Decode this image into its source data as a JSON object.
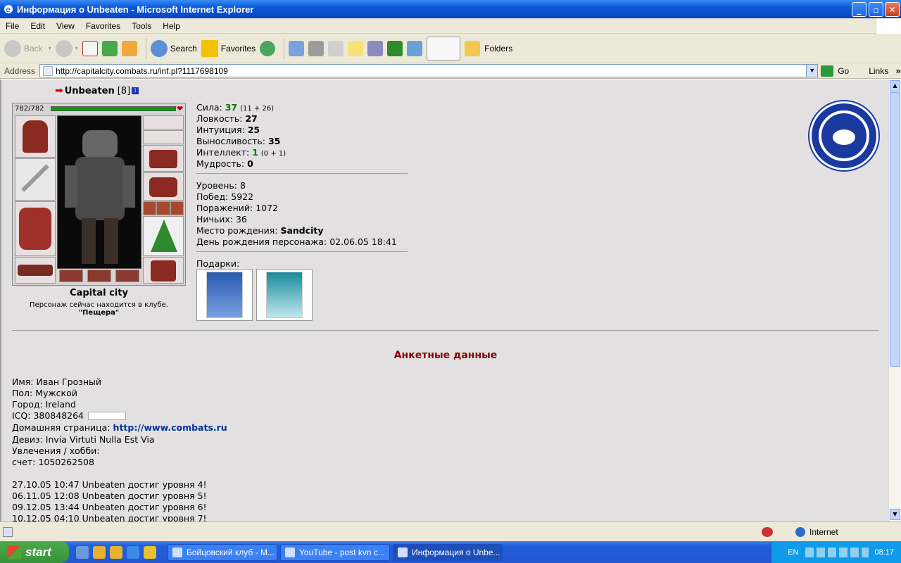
{
  "window": {
    "title": "Информация о Unbeaten - Microsoft Internet Explorer"
  },
  "menu": [
    "File",
    "Edit",
    "View",
    "Favorites",
    "Tools",
    "Help"
  ],
  "toolbar": {
    "back": "Back",
    "search": "Search",
    "favorites": "Favorites",
    "folders": "Folders"
  },
  "address": {
    "label": "Address",
    "url": "http://capitalcity.combats.ru/inf.pl?1117698109",
    "go": "Go",
    "links": "Links"
  },
  "character": {
    "name": "Unbeaten",
    "level": "[8]",
    "hp": "782/782",
    "city": "Capital city",
    "location_note": "Персонаж сейчас находится в клубе.",
    "location": "\"Пещера\""
  },
  "stats": [
    {
      "label": "Сила:",
      "value": "37",
      "extra": "(11 + 26)",
      "green": true
    },
    {
      "label": "Ловкость:",
      "value": "27",
      "extra": "",
      "green": false
    },
    {
      "label": "Интуиция:",
      "value": "25",
      "extra": "",
      "green": false
    },
    {
      "label": "Выносливость:",
      "value": "35",
      "extra": "",
      "green": false
    },
    {
      "label": "Интеллект:",
      "value": "1",
      "extra": "(0 + 1)",
      "green": true
    },
    {
      "label": "Мудрость:",
      "value": "0",
      "extra": "",
      "green": false
    }
  ],
  "info": {
    "level": "Уровень: 8",
    "wins": "Побед: 5922",
    "losses": "Поражений: 1072",
    "draws": "Ничьих: 36",
    "birthplace_label": "Место рождения:",
    "birthplace": "Sandcity",
    "birthday": "День рождения персонажа: 02.06.05 18:41",
    "gifts_label": "Подарки:"
  },
  "profile": {
    "heading": "Анкетные данные",
    "name": "Имя: Иван Грозный",
    "sex": "Пол: Мужской",
    "city": "Город: Ireland",
    "icq": "ICQ: 380848264",
    "homepage_label": "Домашняя страница:",
    "homepage": "http://www.combats.ru",
    "motto": "Девиз: Invia Virtuti Nulla Est Via",
    "hobby": "Увлечения / хобби:",
    "account": "счет: 1050262508"
  },
  "log": [
    "27.10.05 10:47 Unbeaten достиг уровня 4!",
    "06.11.05 12:08 Unbeaten достиг уровня 5!",
    "09.12.05 13:44 Unbeaten достиг уровня 6!",
    "10.12.05 04:10 Unbeaten достиг уровня 7!"
  ],
  "status": {
    "zone": "Internet"
  },
  "taskbar": {
    "start": "start",
    "tasks": [
      "Бойцовский клуб - M...",
      "YouTube - post kvn c...",
      "Информация о Unbe..."
    ],
    "lang": "EN",
    "clock": "08:17"
  }
}
